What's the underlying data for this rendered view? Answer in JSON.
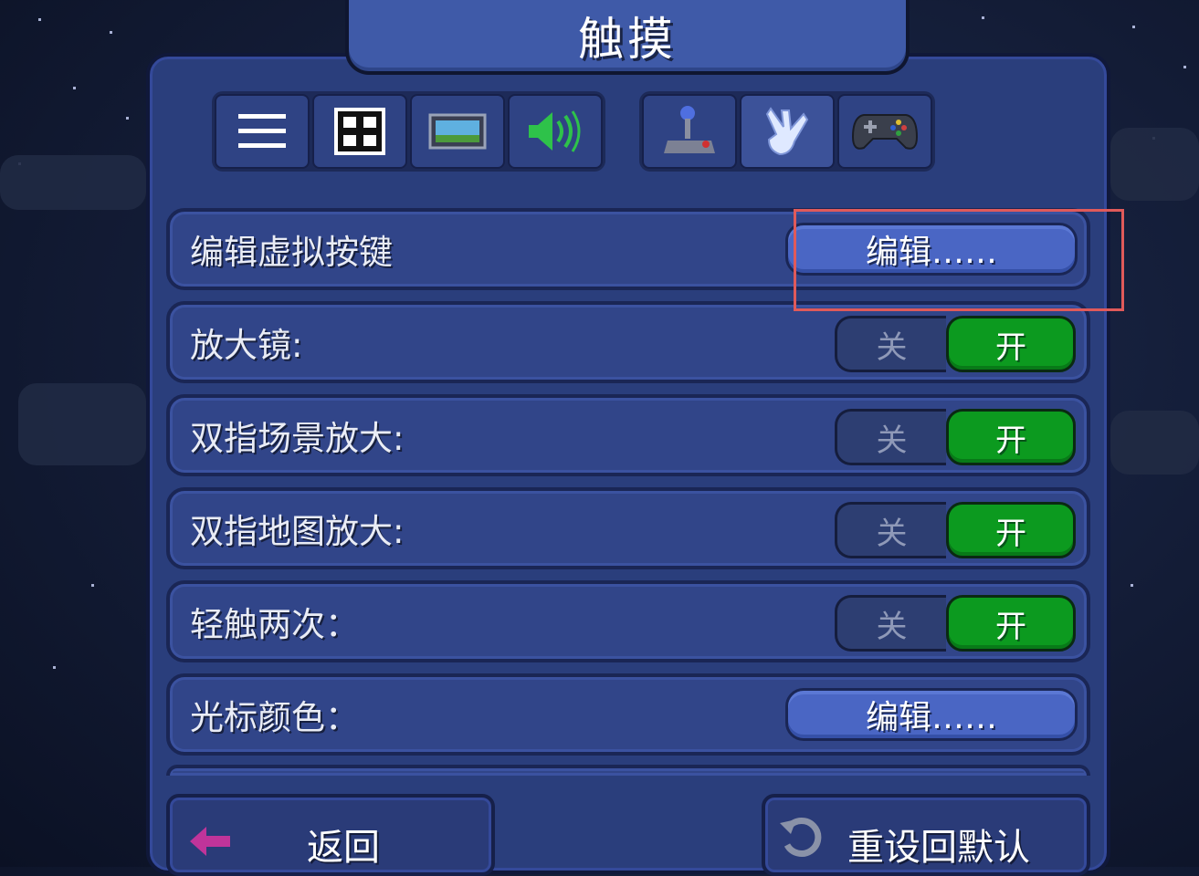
{
  "title": "触摸",
  "tabs": [
    {
      "name": "menu-lines-icon"
    },
    {
      "name": "interface-grid-icon"
    },
    {
      "name": "video-screen-icon"
    },
    {
      "name": "speaker-icon"
    },
    {
      "name": "joystick-icon"
    },
    {
      "name": "touch-hand-icon",
      "active": true
    },
    {
      "name": "gamepad-icon"
    }
  ],
  "settings": {
    "edit_buttons": {
      "label": "编辑虚拟按键",
      "button": "编辑……"
    },
    "magnifier": {
      "label": "放大镜:",
      "off": "关",
      "on": "开",
      "value": "开"
    },
    "pinch_zoom": {
      "label": "双指场景放大:",
      "off": "关",
      "on": "开",
      "value": "开"
    },
    "pinch_map": {
      "label": "双指地图放大:",
      "off": "关",
      "on": "开",
      "value": "开"
    },
    "double_tap": {
      "label": "轻触两次：",
      "off": "关",
      "on": "开",
      "value": "开"
    },
    "cursor_color": {
      "label": "光标颜色：",
      "button": "编辑……"
    }
  },
  "footer": {
    "back_label": "返回",
    "reset_label": "重设回默认"
  },
  "colors": {
    "panel": "#2a3e7c",
    "row": "#314589",
    "toggle_on": "#0c9a1f",
    "edit_button": "#4a66c4",
    "highlight": "#e05a5a"
  }
}
